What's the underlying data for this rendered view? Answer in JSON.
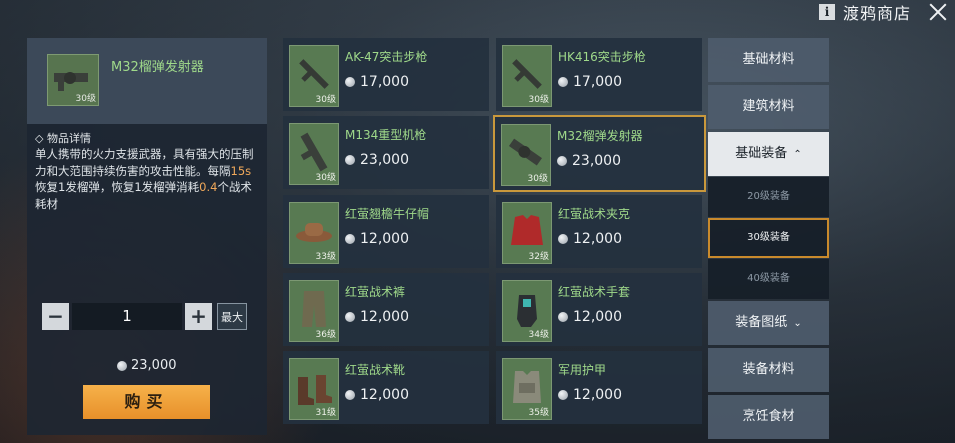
{
  "header": {
    "info_label": "i",
    "title": "渡鸦商店"
  },
  "detail": {
    "name": "M32榴弹发射器",
    "level": "30级",
    "section_label": "◇ 物品详情",
    "desc_part1": "单人携带的火力支援武器，具有强大的压制力和大范围持续伤害的攻击性能。每隔",
    "desc_hl1": "15s",
    "desc_part2": "恢复1发榴弹，恢复1发榴弹消耗",
    "desc_hl2": "0.4",
    "desc_part3": "个战术耗材",
    "qty_minus": "−",
    "qty_value": "1",
    "qty_plus": "+",
    "qty_max": "最大",
    "total_price": "23,000",
    "buy_label": "购买"
  },
  "items": [
    {
      "name": "AK-47突击步枪",
      "price": "17,000",
      "level": "30级",
      "icon": "rifle-icon"
    },
    {
      "name": "HK416突击步枪",
      "price": "17,000",
      "level": "30级",
      "icon": "rifle-icon"
    },
    {
      "name": "M134重型机枪",
      "price": "23,000",
      "level": "30级",
      "icon": "machine-gun-icon"
    },
    {
      "name": "M32榴弹发射器",
      "price": "23,000",
      "level": "30级",
      "icon": "grenade-launcher-icon"
    },
    {
      "name": "红萤翘檐牛仔帽",
      "price": "12,000",
      "level": "33级",
      "icon": "hat-icon"
    },
    {
      "name": "红萤战术夹克",
      "price": "12,000",
      "level": "32级",
      "icon": "jacket-icon"
    },
    {
      "name": "红萤战术裤",
      "price": "12,000",
      "level": "36级",
      "icon": "pants-icon"
    },
    {
      "name": "红萤战术手套",
      "price": "12,000",
      "level": "34级",
      "icon": "gloves-icon"
    },
    {
      "name": "红萤战术靴",
      "price": "12,000",
      "level": "31级",
      "icon": "boots-icon"
    },
    {
      "name": "军用护甲",
      "price": "12,000",
      "level": "35级",
      "icon": "armor-icon"
    }
  ],
  "tabs": {
    "basic_materials": "基础材料",
    "building_materials": "建筑材料",
    "basic_equipment": "基础装备",
    "sub_20": "20级装备",
    "sub_30": "30级装备",
    "sub_40": "40级装备",
    "equipment_blueprints": "装备图纸",
    "equipment_materials": "装备材料",
    "cooking_ingredients": "烹饪食材"
  },
  "colors": {
    "accent": "#c9983c",
    "name_green": "#9fd98a",
    "buy_orange": "#f6b14a",
    "highlight": "#f0a85a"
  }
}
